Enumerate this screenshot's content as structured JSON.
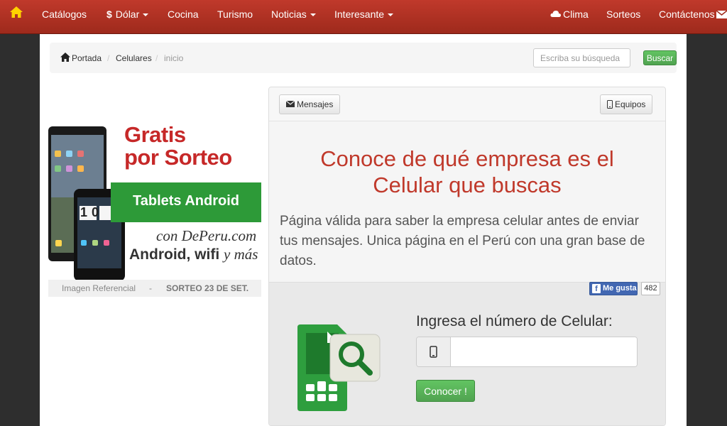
{
  "navbar": {
    "items": [
      "Catálogos",
      "Dólar",
      "Cocina",
      "Turismo",
      "Noticias",
      "Interesante"
    ],
    "dolar_symbol": "$",
    "right_items": [
      "Clima",
      "Sorteos",
      "Contáctenos"
    ],
    "bg_color": "#b03220"
  },
  "breadcrumb": {
    "items": [
      "Portada",
      "Celulares",
      "inicio"
    ],
    "separator": "/"
  },
  "search": {
    "placeholder": "Escriba su búsqueda",
    "button_label": "Buscar"
  },
  "ad": {
    "title_line1": "Gratis",
    "title_line2": "por Sorteo",
    "subtitle": "Tablets Android",
    "brand": "con DePeru.com",
    "features": "Android, wifi",
    "features_suffix": "y más",
    "caption_left": "Imagen Referencial",
    "caption_sep": "-",
    "caption_right": "SORTEO 23 DE SET.",
    "clock_time": "10 08"
  },
  "panel": {
    "messages_label": "Mensajes",
    "devices_label": "Equipos",
    "title_line1": "Conoce de qué empresa es el",
    "title_line2": "Celular que buscas",
    "description": "Página válida para saber la empresa celular antes de enviar tus mensajes. Unica página en el Perú con una gran base de datos.",
    "accent_color": "#c0392b"
  },
  "facebook": {
    "like_label": "Me gusta",
    "like_count": "482"
  },
  "form": {
    "label": "Ingresa el número de Celular:",
    "phone_value": "",
    "submit_label": "Conocer !"
  }
}
